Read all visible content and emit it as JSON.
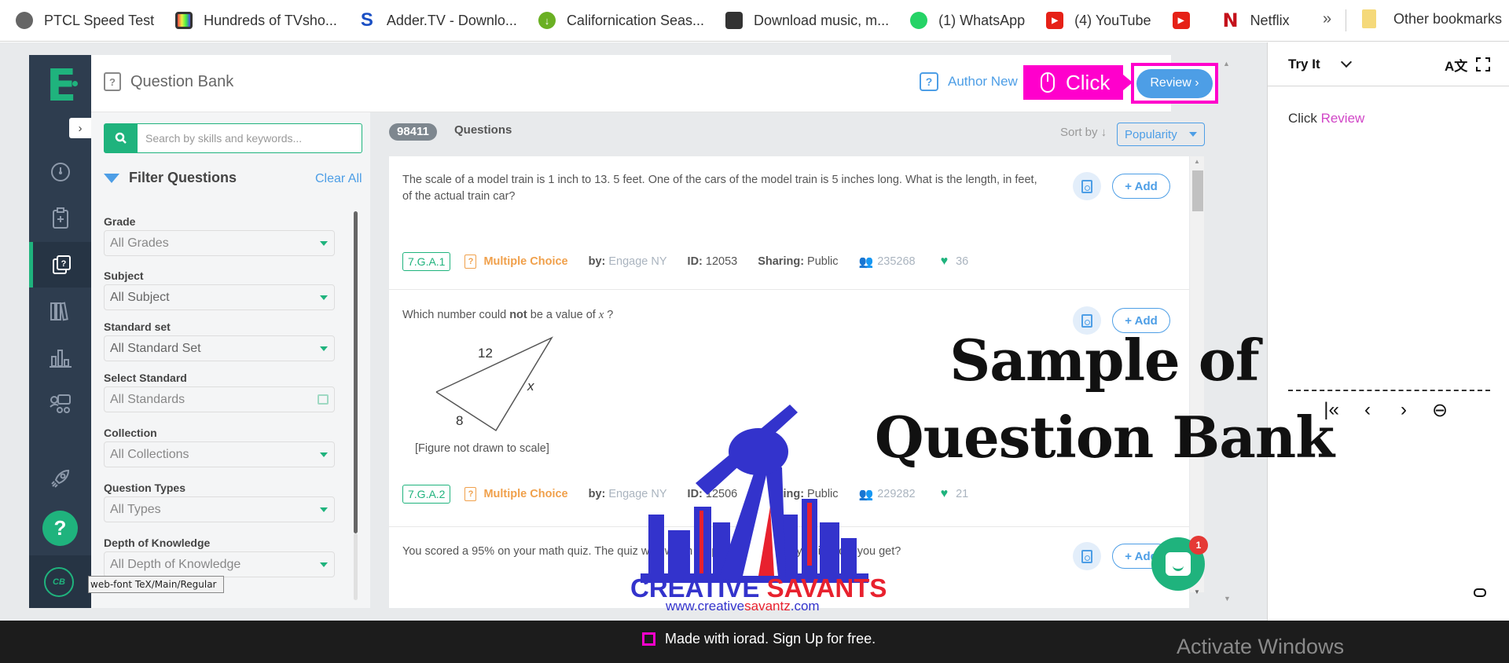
{
  "bookmarks": {
    "items": [
      {
        "label": "PTCL Speed Test",
        "icon": "globe-icon"
      },
      {
        "label": "Hundreds of TVsho...",
        "icon": "tv-icon"
      },
      {
        "label": "Adder.TV - Downlo...",
        "icon": "adder-s-icon"
      },
      {
        "label": "Californication Seas...",
        "icon": "download-arrow-icon"
      },
      {
        "label": "Download music, m...",
        "icon": "car-icon"
      },
      {
        "label": "(1) WhatsApp",
        "icon": "whatsapp-icon"
      },
      {
        "label": "(4) YouTube",
        "icon": "youtube-icon"
      },
      {
        "label": "",
        "icon": "youtube-icon"
      },
      {
        "label": "Netflix",
        "icon": "netflix-icon"
      }
    ],
    "more": "»",
    "other": "Other bookmarks"
  },
  "app": {
    "brand_color": "#1fb37d",
    "accent_color": "#4d9ee6",
    "logo_letter": "E",
    "expander": "›",
    "nav": [
      "dashboard-icon",
      "assignment-icon",
      "question-bank-icon",
      "library-icon",
      "reports-icon",
      "groups-icon",
      "rocket-icon"
    ],
    "help": "?",
    "user_initials": "CB",
    "tooltip": "web-font TeX/Main/Regular"
  },
  "header": {
    "title": "Question Bank",
    "author_new": "Author New",
    "callout": "Click",
    "review": "Review ›"
  },
  "filters": {
    "search_placeholder": "Search by skills and keywords...",
    "title": "Filter Questions",
    "clear_all": "Clear All",
    "fields": [
      {
        "label": "Grade",
        "value": "All Grades"
      },
      {
        "label": "Subject",
        "value": "All Subject"
      },
      {
        "label": "Standard set",
        "value": "All Standard Set"
      },
      {
        "label": "Select Standard",
        "value": "All Standards"
      },
      {
        "label": "Collection",
        "value": "All Collections"
      },
      {
        "label": "Question Types",
        "value": "All Types"
      },
      {
        "label": "Depth of Knowledge",
        "value": "All Depth of Knowledge"
      }
    ]
  },
  "results": {
    "count": "98411",
    "count_label": "Questions",
    "sort_by": "Sort by ↓",
    "sort_value": "Popularity",
    "questions": [
      {
        "text": "The scale of a model train is 1 inch to 13. 5 feet. One of the cars of the model train is 5 inches long. What is the length, in feet, of the actual train car?",
        "standard": "7.G.A.1",
        "type": "Multiple Choice",
        "by_label": "by:",
        "by": "Engage NY",
        "id_label": "ID:",
        "id": "12053",
        "sharing_label": "Sharing:",
        "sharing": "Public",
        "usage": "235268",
        "likes": "36",
        "add": "+ Add"
      },
      {
        "text_pre": "Which number could ",
        "text_bold": "not",
        "text_post": " be a value of ",
        "text_var": "x",
        "text_end": " ?",
        "figure": {
          "side_a": "12",
          "side_b": "8",
          "side_c": "x"
        },
        "caption": "[Figure not drawn to scale]",
        "standard": "7.G.A.2",
        "type": "Multiple Choice",
        "by_label": "by:",
        "by": "Engage NY",
        "id_label": "ID:",
        "id": "12506",
        "sharing_label": "Sharing:",
        "sharing": "Public",
        "usage": "229282",
        "likes": "21",
        "add": "+ Add"
      },
      {
        "text": "You scored a 95% on your math quiz.  The quiz was worth 20 points. How many points did you get?",
        "add": "+ Add"
      }
    ]
  },
  "chat": {
    "badge": "1"
  },
  "overlay": {
    "title": "Sample of Question Bank",
    "logo_name_1": "CREATIVE ",
    "logo_name_2": "SAVANTS",
    "logo_url_1": "www.creative",
    "logo_url_2": "savantz",
    "logo_url_3": ".com"
  },
  "side_panel": {
    "mode": "Try It",
    "instruction_pre": "Click ",
    "instruction_target": "Review",
    "highlight_color": "#d146c7"
  },
  "footer": {
    "iorad": "Made with iorad. Sign Up for free.",
    "watermark": "Activate Windows"
  }
}
